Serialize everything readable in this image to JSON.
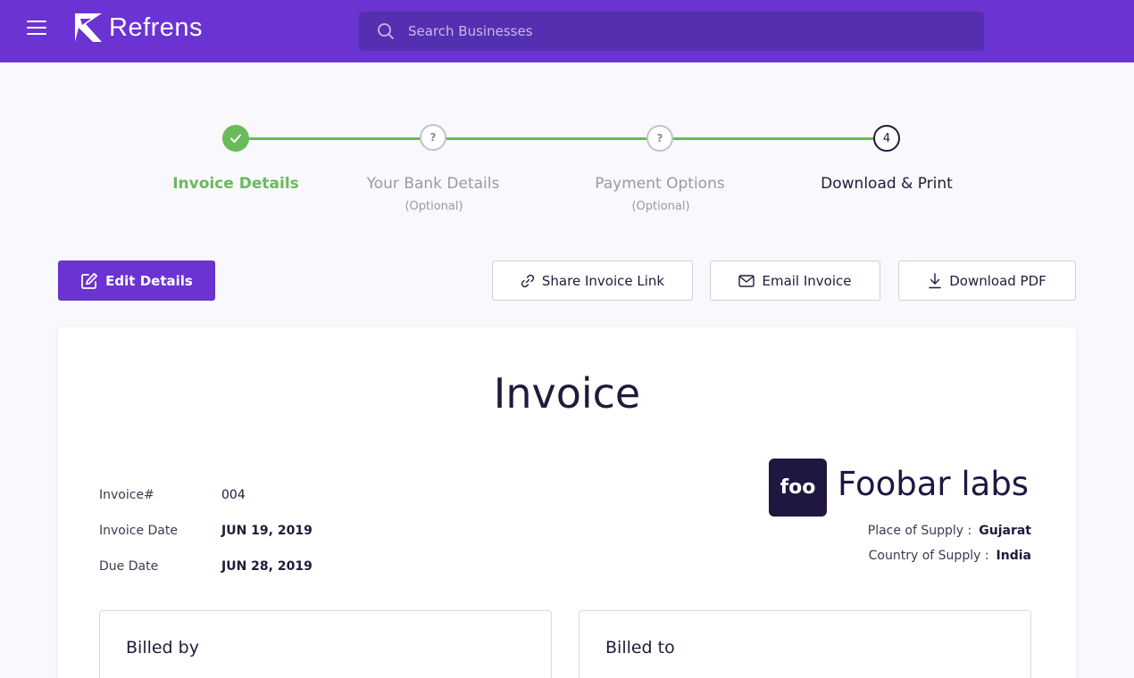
{
  "header": {
    "brand": "Refrens",
    "search_placeholder": "Search Businesses",
    "colors": {
      "bar": "#6b33d1",
      "search": "#5430b0"
    }
  },
  "stepper": {
    "steps": [
      {
        "label": "Invoice Details",
        "sub": "",
        "state": "done",
        "icon": "check-icon"
      },
      {
        "label": "Your Bank Details",
        "sub": "(Optional)",
        "state": "pending",
        "marker": "?"
      },
      {
        "label": "Payment Options",
        "sub": "(Optional)",
        "state": "pending",
        "marker": "?"
      },
      {
        "label": "Download & Print",
        "sub": "",
        "state": "current",
        "marker": "4"
      }
    ],
    "colors": {
      "done": "#6aba5a",
      "pending": "#9b98a8",
      "current": "#1f1b3a"
    }
  },
  "actions": {
    "edit": "Edit Details",
    "share": "Share Invoice Link",
    "email": "Email Invoice",
    "download": "Download PDF"
  },
  "invoice": {
    "title": "Invoice",
    "meta": [
      {
        "label": "Invoice#",
        "value": "004"
      },
      {
        "label": "Invoice Date",
        "value": "JUN 19, 2019"
      },
      {
        "label": "Due Date",
        "value": "JUN 28, 2019"
      }
    ],
    "business": {
      "logo_text": "foo",
      "name": "Foobar labs"
    },
    "supply": {
      "place_label": "Place of Supply :",
      "place_value": "Gujarat",
      "country_label": "Country of Supply :",
      "country_value": "India"
    },
    "billed_by": "Billed by",
    "billed_to": "Billed to"
  }
}
